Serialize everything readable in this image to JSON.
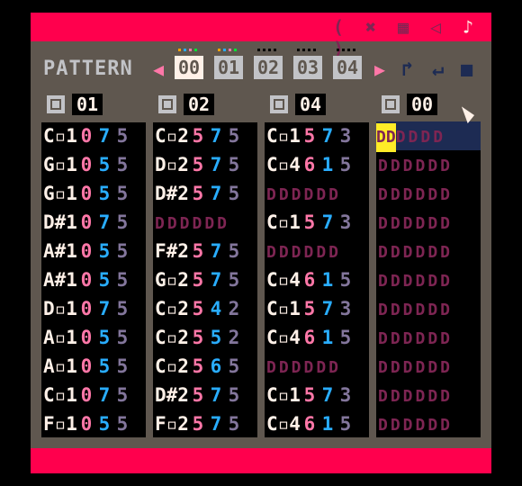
{
  "app": {
    "editor_name": "pico-8-music-editor"
  },
  "topbar": {
    "icons": [
      {
        "name": "code-icon",
        "glyph": "( )"
      },
      {
        "name": "sprite-icon",
        "glyph": "✖"
      },
      {
        "name": "map-icon",
        "glyph": "▦"
      },
      {
        "name": "sfx-icon",
        "glyph": "◁"
      },
      {
        "name": "music-icon",
        "glyph": "♪"
      }
    ]
  },
  "pattern_bar": {
    "label": "PATTERN",
    "prev_glyph": "◀",
    "next_glyph": "▶",
    "slots": [
      "00",
      "01",
      "02",
      "03",
      "04"
    ],
    "selected_slot": "00",
    "loop_start_glyph": "↱",
    "loop_back_glyph": "↵",
    "stop_glyph": "■"
  },
  "channels": [
    {
      "sfx": "01",
      "enabled": true,
      "rows": [
        {
          "p": "C",
          "a": "▫",
          "o": "1",
          "i": "0",
          "v": "7",
          "f": "5"
        },
        {
          "p": "G",
          "a": "▫",
          "o": "1",
          "i": "0",
          "v": "5",
          "f": "5"
        },
        {
          "p": "G",
          "a": "▫",
          "o": "1",
          "i": "0",
          "v": "5",
          "f": "5"
        },
        {
          "p": "D",
          "a": "#",
          "o": "1",
          "i": "0",
          "v": "7",
          "f": "5"
        },
        {
          "p": "A",
          "a": "#",
          "o": "1",
          "i": "0",
          "v": "5",
          "f": "5"
        },
        {
          "p": "A",
          "a": "#",
          "o": "1",
          "i": "0",
          "v": "5",
          "f": "5"
        },
        {
          "p": "D",
          "a": "▫",
          "o": "1",
          "i": "0",
          "v": "7",
          "f": "5"
        },
        {
          "p": "A",
          "a": "▫",
          "o": "1",
          "i": "0",
          "v": "5",
          "f": "5"
        },
        {
          "p": "A",
          "a": "▫",
          "o": "1",
          "i": "0",
          "v": "5",
          "f": "5"
        },
        {
          "p": "C",
          "a": "▫",
          "o": "1",
          "i": "0",
          "v": "7",
          "f": "5"
        },
        {
          "p": "F",
          "a": "▫",
          "o": "1",
          "i": "0",
          "v": "5",
          "f": "5"
        }
      ]
    },
    {
      "sfx": "02",
      "enabled": true,
      "rows": [
        {
          "p": "C",
          "a": "▫",
          "o": "2",
          "i": "5",
          "v": "7",
          "f": "5"
        },
        {
          "p": "D",
          "a": "▫",
          "o": "2",
          "i": "5",
          "v": "7",
          "f": "5"
        },
        {
          "p": "D",
          "a": "#",
          "o": "2",
          "i": "5",
          "v": "7",
          "f": "5"
        },
        {
          "empty": "DDDDDD"
        },
        {
          "p": "F",
          "a": "#",
          "o": "2",
          "i": "5",
          "v": "7",
          "f": "5"
        },
        {
          "p": "G",
          "a": "▫",
          "o": "2",
          "i": "5",
          "v": "7",
          "f": "5"
        },
        {
          "p": "C",
          "a": "▫",
          "o": "2",
          "i": "5",
          "v": "4",
          "f": "2"
        },
        {
          "p": "C",
          "a": "▫",
          "o": "2",
          "i": "5",
          "v": "5",
          "f": "2"
        },
        {
          "p": "C",
          "a": "▫",
          "o": "2",
          "i": "5",
          "v": "6",
          "f": "5"
        },
        {
          "p": "D",
          "a": "#",
          "o": "2",
          "i": "5",
          "v": "7",
          "f": "5"
        },
        {
          "p": "F",
          "a": "▫",
          "o": "2",
          "i": "5",
          "v": "7",
          "f": "5"
        }
      ]
    },
    {
      "sfx": "04",
      "enabled": true,
      "rows": [
        {
          "p": "C",
          "a": "▫",
          "o": "1",
          "i": "5",
          "v": "7",
          "f": "3"
        },
        {
          "p": "C",
          "a": "▫",
          "o": "4",
          "i": "6",
          "v": "1",
          "f": "5"
        },
        {
          "empty": "DDDDDD"
        },
        {
          "p": "C",
          "a": "▫",
          "o": "1",
          "i": "5",
          "v": "7",
          "f": "3"
        },
        {
          "empty": "DDDDDD"
        },
        {
          "p": "C",
          "a": "▫",
          "o": "4",
          "i": "6",
          "v": "1",
          "f": "5"
        },
        {
          "p": "C",
          "a": "▫",
          "o": "1",
          "i": "5",
          "v": "7",
          "f": "3"
        },
        {
          "p": "C",
          "a": "▫",
          "o": "4",
          "i": "6",
          "v": "1",
          "f": "5"
        },
        {
          "empty": "DDDDDD"
        },
        {
          "p": "C",
          "a": "▫",
          "o": "1",
          "i": "5",
          "v": "7",
          "f": "3"
        },
        {
          "p": "C",
          "a": "▫",
          "o": "4",
          "i": "6",
          "v": "1",
          "f": "5"
        }
      ]
    },
    {
      "sfx": "00",
      "enabled": true,
      "rows": [
        {
          "empty": "DDDDDD",
          "cursor": "DD"
        },
        {
          "empty": "DDDDDD"
        },
        {
          "empty": "DDDDDD"
        },
        {
          "empty": "DDDDDD"
        },
        {
          "empty": "DDDDDD"
        },
        {
          "empty": "DDDDDD"
        },
        {
          "empty": "DDDDDD"
        },
        {
          "empty": "DDDDDD"
        },
        {
          "empty": "DDDDDD"
        },
        {
          "empty": "DDDDDD"
        },
        {
          "empty": "DDDDDD"
        }
      ]
    }
  ]
}
